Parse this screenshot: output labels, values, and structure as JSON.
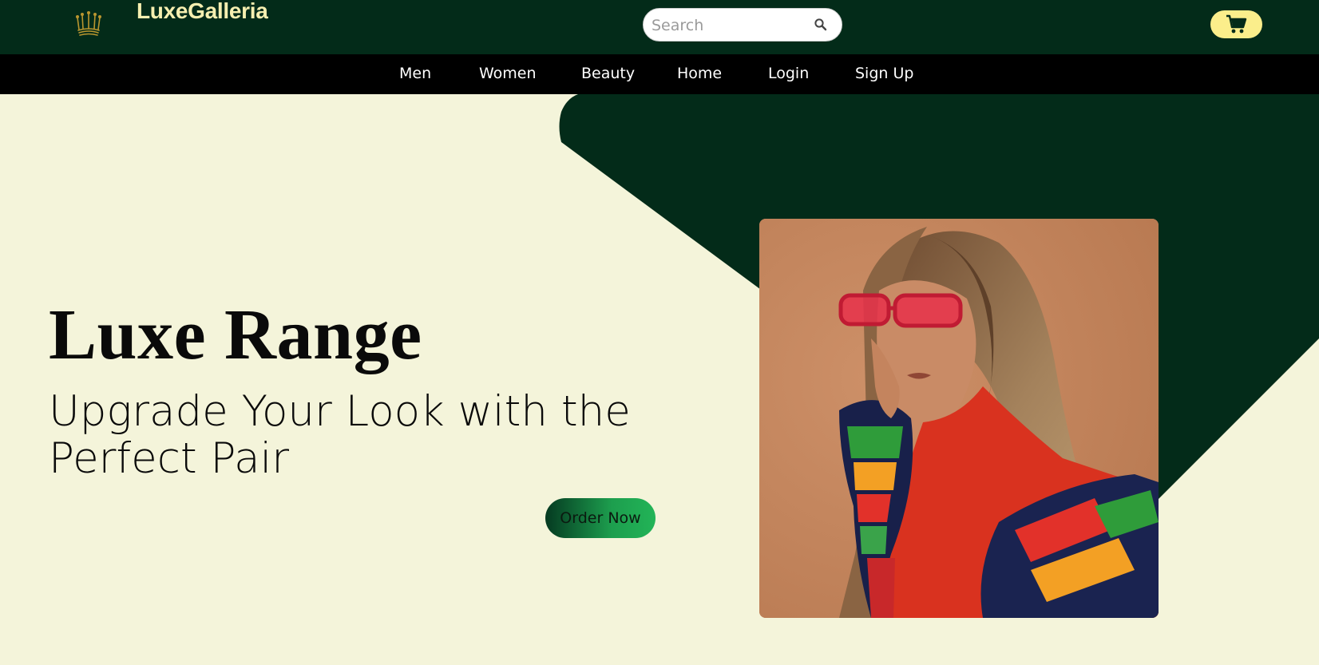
{
  "header": {
    "brand": "LuxeGalleria",
    "logo_icon": "crown-icon",
    "search": {
      "placeholder": "Search",
      "value": "",
      "icon": "search-icon"
    },
    "cart_icon": "cart-icon"
  },
  "nav": {
    "items": [
      {
        "label": "Men"
      },
      {
        "label": "Women"
      },
      {
        "label": "Beauty"
      },
      {
        "label": "Home"
      },
      {
        "label": "Login"
      },
      {
        "label": "Sign Up"
      }
    ]
  },
  "hero": {
    "title": "Luxe Range",
    "subtitle": "Upgrade Your Look with the Perfect Pair",
    "cta_label": "Order Now"
  },
  "colors": {
    "header_bg": "#032b19",
    "nav_bg": "#000000",
    "page_bg": "#f4f4da",
    "brand_text": "#f6efb0",
    "cart_bg": "#fbee8b",
    "accent_green": "#22b457"
  }
}
